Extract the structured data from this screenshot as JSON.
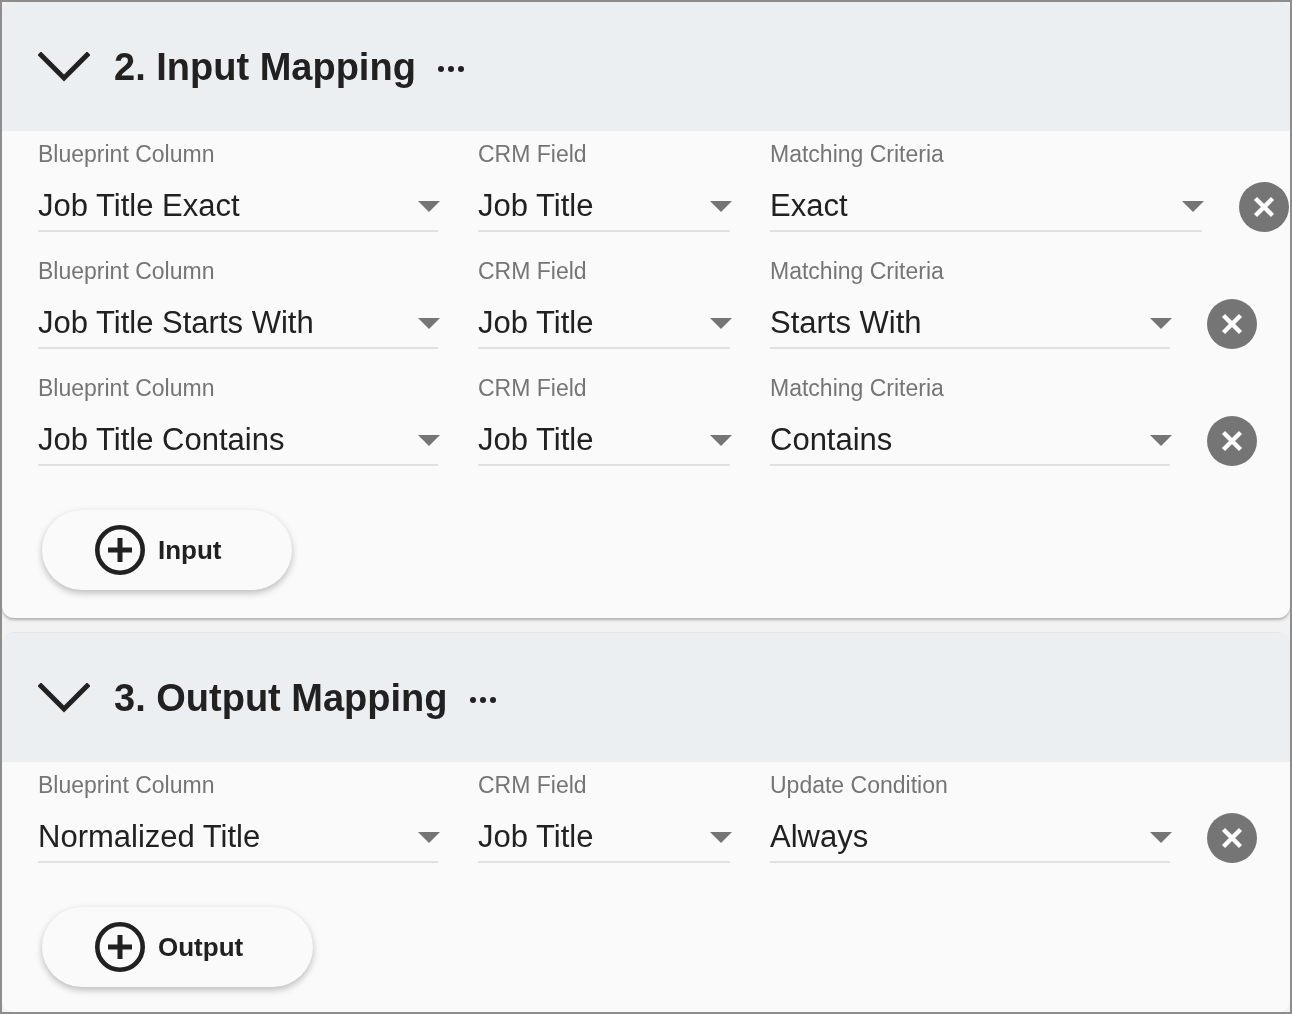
{
  "sections": [
    {
      "title": "2. Input Mapping",
      "expanded": true,
      "rows": [
        {
          "fields": [
            {
              "label": "Blueprint Column",
              "value": "Job Title Exact"
            },
            {
              "label": "CRM Field",
              "value": "Job Title"
            },
            {
              "label": "Matching Criteria",
              "value": "Exact"
            }
          ]
        },
        {
          "fields": [
            {
              "label": "Blueprint Column",
              "value": "Job Title Starts With"
            },
            {
              "label": "CRM Field",
              "value": "Job Title"
            },
            {
              "label": "Matching Criteria",
              "value": "Starts With"
            }
          ]
        },
        {
          "fields": [
            {
              "label": "Blueprint Column",
              "value": "Job Title Contains"
            },
            {
              "label": "CRM Field",
              "value": "Job Title"
            },
            {
              "label": "Matching Criteria",
              "value": "Contains"
            }
          ]
        }
      ],
      "add_button": "Input"
    },
    {
      "title": "3. Output Mapping",
      "expanded": true,
      "rows": [
        {
          "fields": [
            {
              "label": "Blueprint Column",
              "value": "Normalized Title"
            },
            {
              "label": "CRM Field",
              "value": "Job Title"
            },
            {
              "label": "Update Condition",
              "value": "Always"
            }
          ]
        }
      ],
      "add_button": "Output"
    }
  ]
}
